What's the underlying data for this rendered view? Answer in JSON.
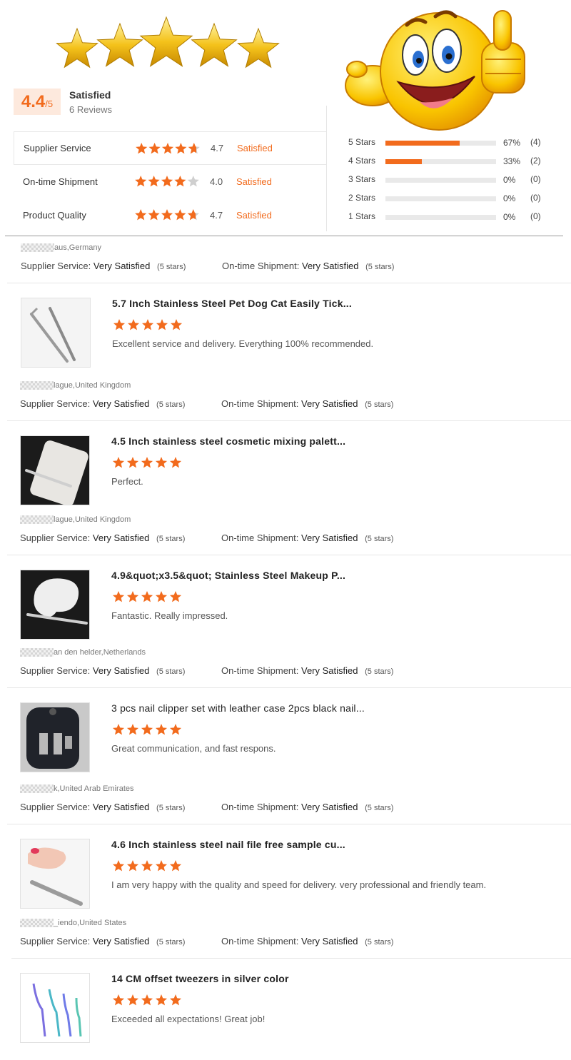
{
  "summary": {
    "score": "4.4",
    "score_den": "/5",
    "title": "Satisfied",
    "reviews": "6 Reviews",
    "ratings": [
      {
        "label": "Supplier Service",
        "value": "4.7",
        "stars": 4.7,
        "status": "Satisfied"
      },
      {
        "label": "On-time Shipment",
        "value": "4.0",
        "stars": 4.0,
        "status": "Satisfied"
      },
      {
        "label": "Product Quality",
        "value": "4.7",
        "stars": 4.7,
        "status": "Satisfied"
      }
    ],
    "distribution": [
      {
        "label": "5  Stars",
        "pct": "67%",
        "count": "(4)",
        "fraction": 0.67
      },
      {
        "label": "4  Stars",
        "pct": "33%",
        "count": "(2)",
        "fraction": 0.33
      },
      {
        "label": "3  Stars",
        "pct": "0%",
        "count": "(0)",
        "fraction": 0
      },
      {
        "label": "2  Stars",
        "pct": "0%",
        "count": "(0)",
        "fraction": 0
      },
      {
        "label": "1  Stars",
        "pct": "0%",
        "count": "(0)",
        "fraction": 0
      }
    ]
  },
  "labels": {
    "supplier_service": "Supplier Service:",
    "ontime_shipment": "On-time Shipment:",
    "very_satisfied": "Very Satisfied",
    "five_stars": "(5 stars)"
  },
  "first_review": {
    "location": "aus,Germany"
  },
  "reviews": [
    {
      "title": "5.7 Inch Stainless Steel Pet Dog Cat Easily Tick...",
      "rating": 5,
      "text": "Excellent service and delivery. Everything 100% recommended.",
      "location": "lague,United Kingdom"
    },
    {
      "title": "4.5 Inch stainless steel cosmetic mixing palett...",
      "rating": 5,
      "text": "Perfect.",
      "location": "lague,United Kingdom"
    },
    {
      "title": "4.9&quot;x3.5&quot; Stainless Steel Makeup P...",
      "rating": 5,
      "text": "Fantastic. Really impressed.",
      "location": "an den helder,Netherlands"
    },
    {
      "title": "3 pcs nail clipper set with leather case 2pcs black nail...",
      "rating": 5,
      "text": "Great communication, and fast respons.",
      "location": "k,United Arab Emirates"
    },
    {
      "title": "4.6 Inch stainless steel nail file free sample cu...",
      "rating": 5,
      "text": "I am very happy with the quality and speed for delivery.  very professional and friendly team.",
      "location": "_iendo,United States"
    },
    {
      "title": "14 CM offset tweezers in silver color",
      "rating": 5,
      "text": "Exceeded all expectations! Great job!"
    }
  ],
  "colors": {
    "accent": "#f26b1d",
    "accent_light": "#fde9dd",
    "star_empty": "#cfcfcf",
    "gold": "#f4b400"
  }
}
